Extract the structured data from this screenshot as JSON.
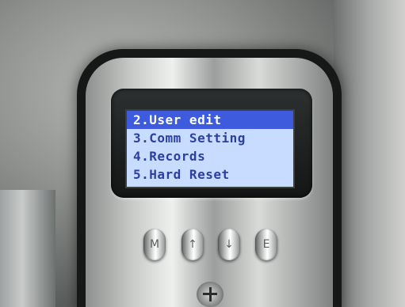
{
  "menu": {
    "items": [
      "2.User edit",
      "3.Comm Setting",
      "4.Records",
      "5.Hard Reset"
    ],
    "selected_index": 0
  },
  "keypad": {
    "buttons": [
      "M",
      "↑",
      "↓",
      "E"
    ]
  },
  "colors": {
    "lcd_background": "#c8dcff",
    "lcd_text": "#2c3fa3",
    "highlight": "#3d5bdc"
  }
}
